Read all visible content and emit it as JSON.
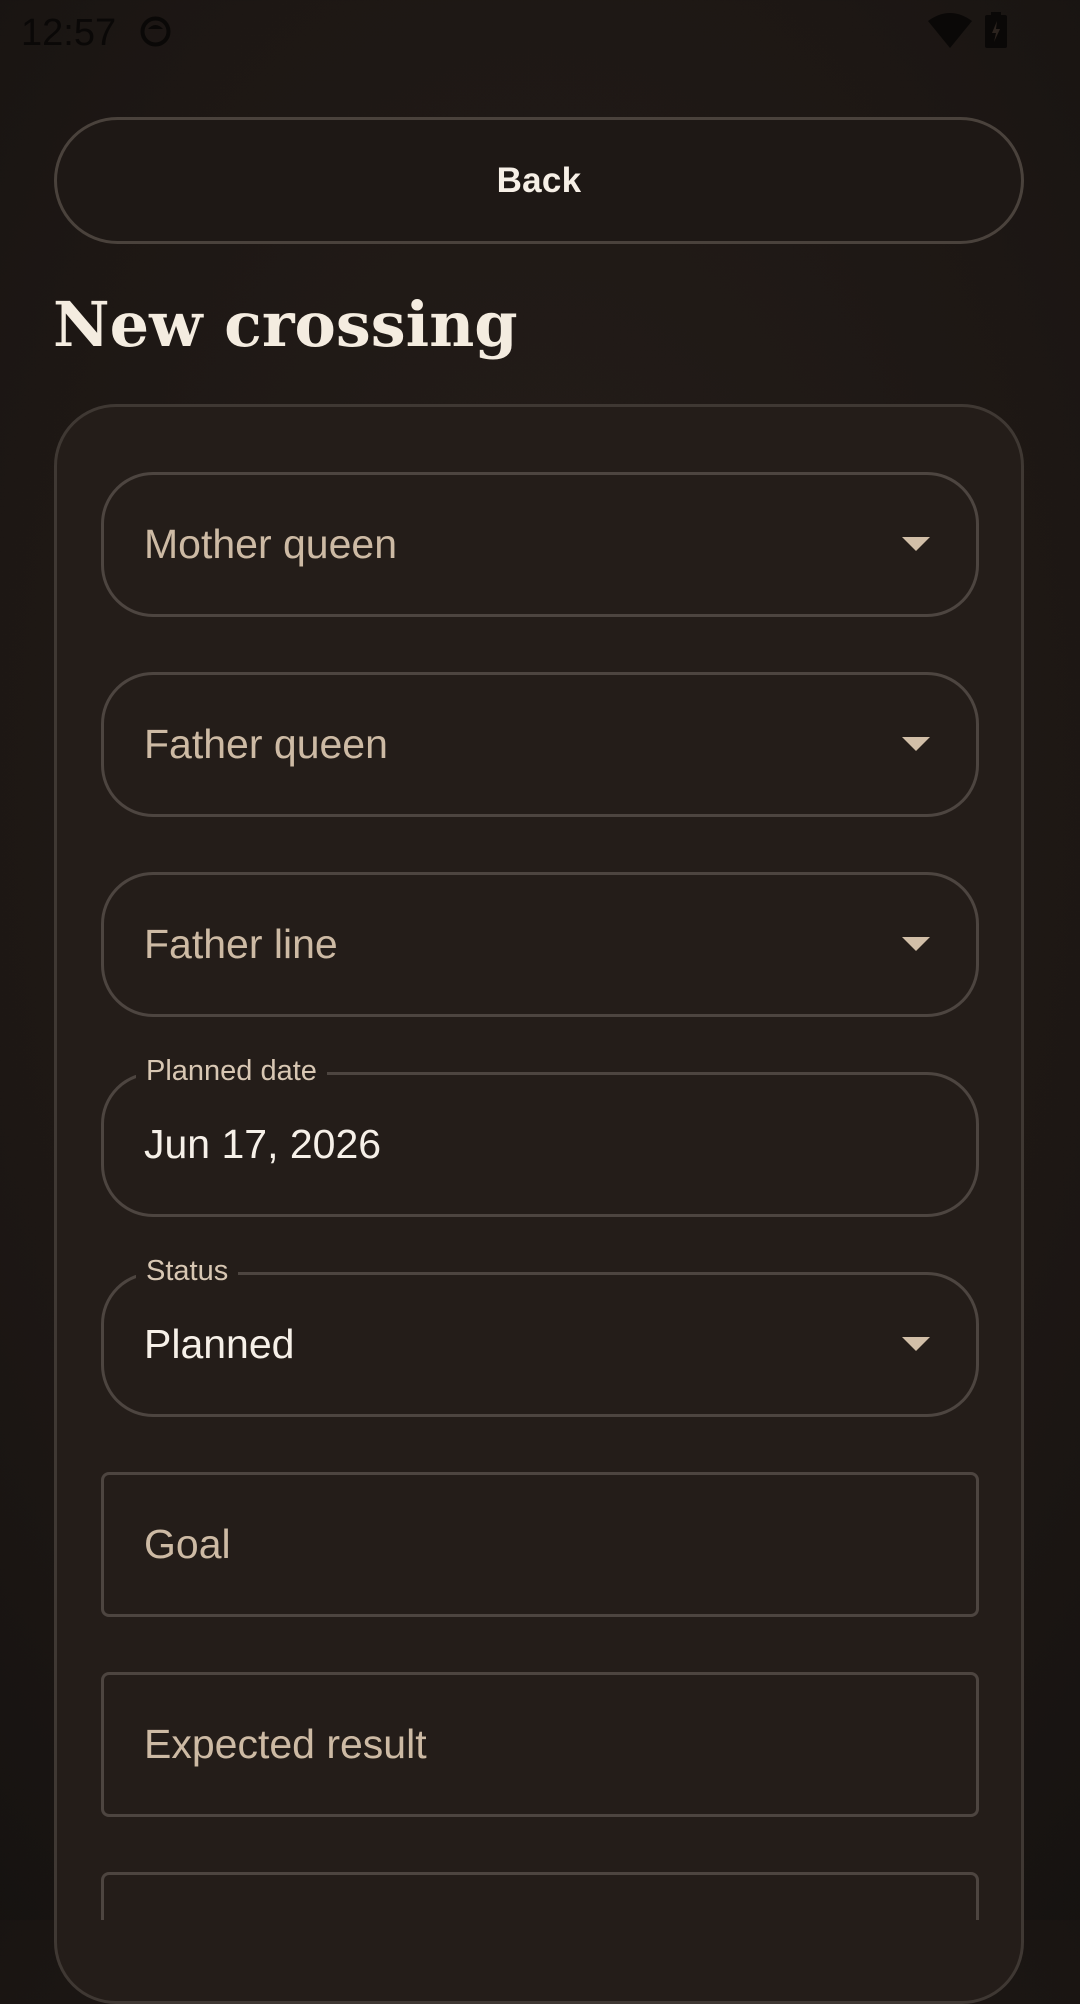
{
  "status_bar": {
    "time": "12:57",
    "icons": [
      "circle-status-icon",
      "wifi-icon",
      "battery-icon"
    ]
  },
  "header": {
    "back_label": "Back",
    "title": "New crossing"
  },
  "form": {
    "mother_queen": {
      "placeholder": "Mother queen"
    },
    "father_queen": {
      "placeholder": "Father queen"
    },
    "father_line": {
      "placeholder": "Father line"
    },
    "planned_date": {
      "label": "Planned date",
      "value": "Jun 17, 2026"
    },
    "status": {
      "label": "Status",
      "value": "Planned"
    },
    "goal": {
      "placeholder": "Goal"
    },
    "expected_result": {
      "placeholder": "Expected result"
    }
  },
  "colors": {
    "background": "#1d1714",
    "card": "#241d19",
    "border": "#4d4540",
    "placeholder": "#cdbaa4",
    "text": "#f6f0e8"
  }
}
